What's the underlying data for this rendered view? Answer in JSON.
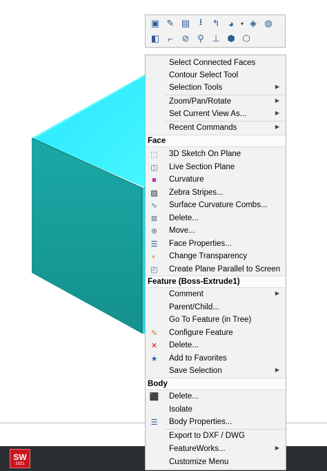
{
  "toolbar": {
    "row1": [
      {
        "icon": "view-orientation-icon",
        "glyph": "▣"
      },
      {
        "icon": "edit-sketch-icon",
        "glyph": "✎"
      },
      {
        "icon": "edit-feature-icon",
        "glyph": "▤"
      },
      {
        "icon": "normal-to-icon",
        "glyph": "⭳"
      },
      {
        "icon": "back-arrow-icon",
        "glyph": "↰"
      },
      {
        "icon": "appearance-icon",
        "glyph": "◕"
      },
      {
        "icon": "dropdown-arrow-icon",
        "glyph": "▾",
        "drop": true
      },
      {
        "icon": "hide-show-icon",
        "glyph": "◈"
      },
      {
        "icon": "color-icon",
        "glyph": "◍"
      }
    ],
    "row2": [
      {
        "icon": "section-view-icon",
        "glyph": "◧"
      },
      {
        "icon": "sketch-corner-icon",
        "glyph": "⌐"
      },
      {
        "icon": "hide-icon",
        "glyph": "⊘"
      },
      {
        "icon": "zoom-to-selection-icon",
        "glyph": "⚲"
      },
      {
        "icon": "datum-axis-icon",
        "glyph": "⊥"
      },
      {
        "icon": "isolate-icon",
        "glyph": "⬢"
      },
      {
        "icon": "box-icon",
        "glyph": "⬡"
      }
    ]
  },
  "menu": {
    "top_items": [
      {
        "label": "Select Connected Faces"
      },
      {
        "label": "Contour Select Tool"
      },
      {
        "label": "Selection Tools",
        "submenu": true
      },
      {
        "label": "Zoom/Pan/Rotate",
        "submenu": true
      },
      {
        "label": "Set Current View As...",
        "submenu": true
      },
      {
        "label": "Recent Commands",
        "submenu": true
      }
    ],
    "face_header": "Face",
    "face_items": [
      {
        "label": "3D Sketch On Plane",
        "icon": "sketch-3d-icon",
        "glyph": "⬚",
        "color": "#4a6fa5"
      },
      {
        "label": "Live Section Plane",
        "icon": "section-plane-icon",
        "glyph": "◫",
        "color": "#5a6a7a"
      },
      {
        "label": "Curvature",
        "icon": "curvature-icon",
        "glyph": "■",
        "color": "#c03aa0"
      },
      {
        "label": "Zebra Stripes...",
        "icon": "zebra-stripes-icon",
        "glyph": "▨",
        "color": "#222222"
      },
      {
        "label": "Surface Curvature Combs...",
        "icon": "curvature-combs-icon",
        "glyph": "∿",
        "color": "#3a6ea5"
      },
      {
        "label": "Delete...",
        "icon": "delete-face-icon",
        "glyph": "⊠",
        "color": "#5c6f86"
      },
      {
        "label": "Move...",
        "icon": "move-face-icon",
        "glyph": "⊕",
        "color": "#5c6f86"
      },
      {
        "label": "Face Properties...",
        "icon": "face-properties-icon",
        "glyph": "☰",
        "color": "#2d5fa8"
      },
      {
        "label": "Change Transparency",
        "icon": "transparency-icon",
        "glyph": "◐",
        "color": "#e09a2a"
      },
      {
        "label": "Create Plane Parallel to Screen",
        "icon": "plane-parallel-icon",
        "glyph": "◰",
        "color": "#3b6ea5"
      }
    ],
    "feature_header": "Feature (Boss-Extrude1)",
    "feature_items": [
      {
        "label": "Comment",
        "submenu": true
      },
      {
        "label": "Parent/Child..."
      },
      {
        "label": "Go To Feature (in Tree)"
      },
      {
        "label": "Configure Feature",
        "icon": "configure-feature-icon",
        "glyph": "✎",
        "color": "#c8841a"
      },
      {
        "label": "Delete...",
        "icon": "delete-x-icon",
        "glyph": "✕",
        "color": "#d01818"
      },
      {
        "label": "Add to Favorites",
        "icon": "favorites-star-icon",
        "glyph": "★",
        "color": "#2d5fa8"
      },
      {
        "label": "Save Selection",
        "submenu": true
      }
    ],
    "body_header": "Body",
    "body_items": [
      {
        "label": "Delete...",
        "icon": "delete-body-icon",
        "glyph": "⬛",
        "color": "#2d6ea8"
      },
      {
        "label": "Isolate"
      },
      {
        "label": "Body Properties...",
        "icon": "body-properties-icon",
        "glyph": "☰",
        "color": "#2d5fa8"
      }
    ],
    "bottom_items": [
      {
        "label": "Export to DXF / DWG"
      },
      {
        "label": "FeatureWorks...",
        "submenu": true
      },
      {
        "label": "Customize Menu"
      }
    ]
  },
  "taskbar": {
    "app_label": "SW",
    "app_year": "2021"
  },
  "colors": {
    "cube_top": "#33f0ff",
    "cube_side": "#2bd4e0",
    "cube_front": "#1a9e9a"
  }
}
